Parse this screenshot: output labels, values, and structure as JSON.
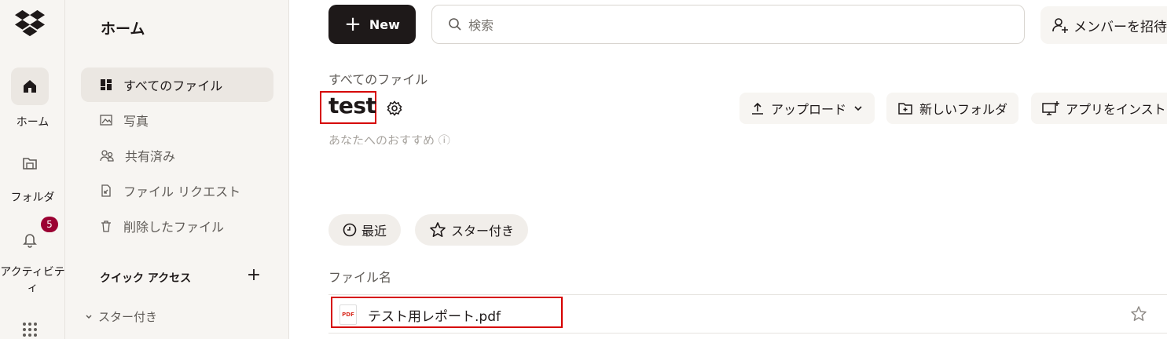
{
  "rail": {
    "home_label": "ホーム",
    "folders_label": "フォルダ",
    "activity_label_1": "アクティビテ",
    "activity_label_2": "ィ",
    "activity_badge": "5"
  },
  "sidebar": {
    "title": "ホーム",
    "items": [
      {
        "label": "すべてのファイル",
        "icon": "all-files-icon"
      },
      {
        "label": "写真",
        "icon": "photos-icon"
      },
      {
        "label": "共有済み",
        "icon": "shared-icon"
      },
      {
        "label": "ファイル リクエスト",
        "icon": "file-request-icon"
      },
      {
        "label": "削除したファイル",
        "icon": "trash-icon"
      }
    ],
    "quick_access_title": "クイック アクセス",
    "starred_section": "スター付き"
  },
  "toolbar": {
    "new_label": "New",
    "search_placeholder": "検索",
    "invite_label": "メンバーを招待"
  },
  "main": {
    "breadcrumb": "すべてのファイル",
    "title": "test",
    "ghost_text": "あなたへのおすすめ ⓘ",
    "actions": {
      "upload": "アップロード",
      "new_folder": "新しいフォルダ",
      "install_app": "アプリをインストール"
    },
    "filters": {
      "recent": "最近",
      "starred": "スター付き"
    },
    "column_header": "ファイル名",
    "files": [
      {
        "name": "テスト用レポート.pdf",
        "type_badge": "PDF"
      }
    ]
  },
  "colors": {
    "accent_dark": "#1e1919",
    "sidebar_bg": "#f7f5f2",
    "badge": "#9b0032",
    "highlight_box": "#d60000"
  }
}
